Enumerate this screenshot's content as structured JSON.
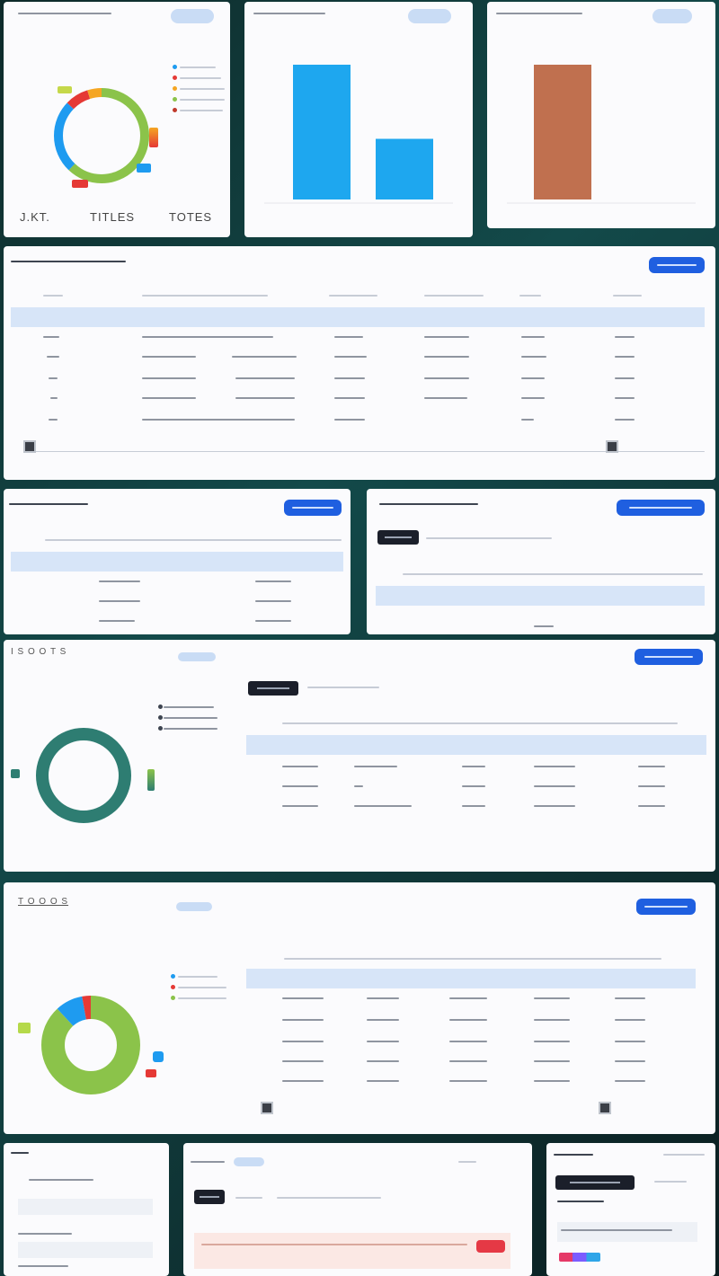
{
  "colors": {
    "accent": "#1f5fe0",
    "bar_blue": "#1ea7ef",
    "bar_rust": "#c0704f",
    "donut_green": "#8bc34a",
    "donut_blue": "#1e9bf0",
    "donut_red": "#e53935",
    "donut_teal": "#2e7d72",
    "highlight_row": "#d7e5f8"
  },
  "panel_donut_1": {
    "donut": [
      {
        "color": "#8bc34a",
        "value": 0.62
      },
      {
        "color": "#1e9bf0",
        "value": 0.25
      },
      {
        "color": "#e53935",
        "value": 0.08
      },
      {
        "color": "#f5a623",
        "value": 0.05
      }
    ],
    "footer_labels": [
      "J.KT.",
      "TITLES",
      "TOTES"
    ]
  },
  "panel_bar_1": {
    "chart_data": {
      "type": "bar",
      "values": [
        100,
        45
      ],
      "ylim": [
        0,
        110
      ]
    }
  },
  "panel_bar_2": {
    "chart_data": {
      "type": "bar",
      "values": [
        100
      ],
      "ylim": [
        0,
        110
      ]
    }
  },
  "panel_donut_2": {
    "header": "I S O O T S",
    "donut": [
      {
        "color": "#2e7d72",
        "value": 1.0
      }
    ]
  },
  "panel_donut_3": {
    "header": "T O O O S",
    "donut": [
      {
        "color": "#8bc34a",
        "value": 0.88
      },
      {
        "color": "#1e9bf0",
        "value": 0.09
      },
      {
        "color": "#e53935",
        "value": 0.03
      }
    ]
  }
}
